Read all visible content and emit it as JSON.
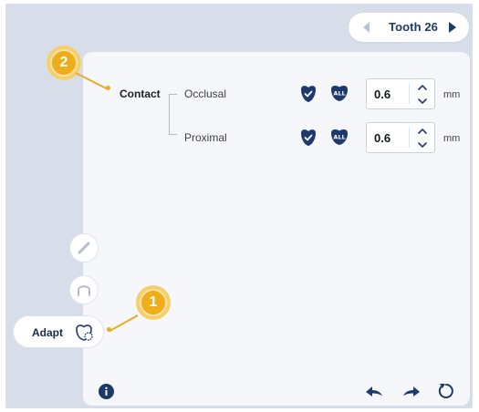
{
  "tooth_nav": {
    "label": "Tooth 26"
  },
  "contact": {
    "title": "Contact",
    "rows": [
      {
        "label": "Occlusal",
        "value": "0.6",
        "unit": "mm",
        "all_label": "ALL"
      },
      {
        "label": "Proximal",
        "value": "0.6",
        "unit": "mm",
        "all_label": "ALL"
      }
    ]
  },
  "side_tools": {
    "adapt_label": "Adapt"
  },
  "callouts": {
    "first": "1",
    "second": "2"
  },
  "colors": {
    "accent_dark": "#1d3a6b",
    "callout": "#eeae1b",
    "panel": "#f5f7fa",
    "background": "#d7deea"
  },
  "icons": [
    "chevron-left-icon",
    "chevron-right-icon",
    "tooth-check-icon",
    "tooth-all-icon",
    "chevron-up-icon",
    "chevron-down-icon",
    "pencil-icon",
    "arch-icon",
    "tooth-adapt-icon",
    "info-icon",
    "undo-icon",
    "redo-icon",
    "reset-icon"
  ]
}
